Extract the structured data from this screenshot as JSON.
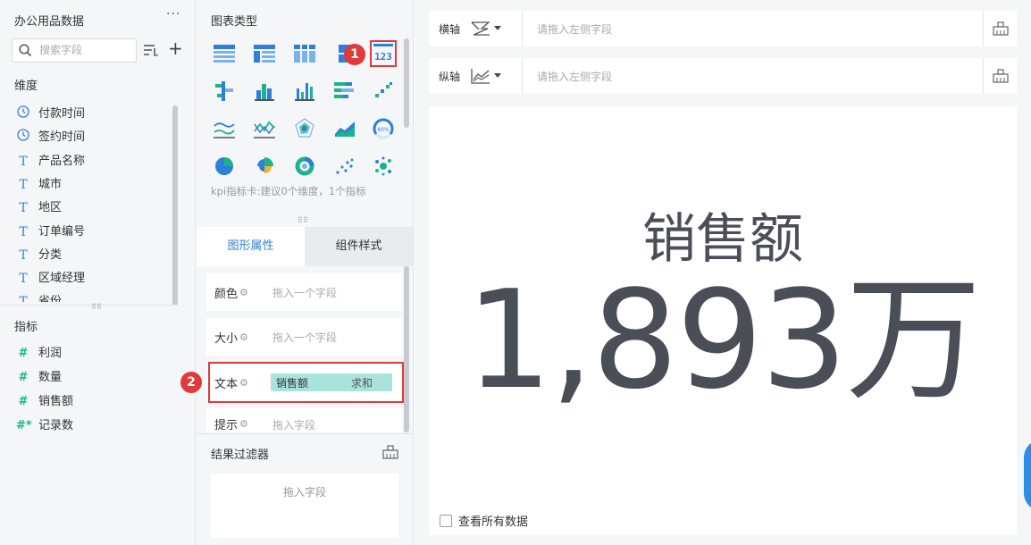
{
  "dataset": {
    "title": "办公用品数据",
    "more": "···"
  },
  "search": {
    "placeholder": "搜索字段"
  },
  "dimensions": {
    "label": "维度",
    "items": [
      {
        "name": "付款时间",
        "icon": "clock-icon"
      },
      {
        "name": "签约时间",
        "icon": "clock-icon"
      },
      {
        "name": "产品名称",
        "icon": "text-type-icon"
      },
      {
        "name": "城市",
        "icon": "text-type-icon"
      },
      {
        "name": "地区",
        "icon": "text-type-icon"
      },
      {
        "name": "订单编号",
        "icon": "text-type-icon"
      },
      {
        "name": "分类",
        "icon": "text-type-icon"
      },
      {
        "name": "区域经理",
        "icon": "text-type-icon"
      },
      {
        "name": "省份",
        "icon": "text-type-icon"
      }
    ]
  },
  "measures": {
    "label": "指标",
    "items": [
      {
        "name": "利润",
        "icon": "#"
      },
      {
        "name": "数量",
        "icon": "#"
      },
      {
        "name": "销售额",
        "icon": "#"
      },
      {
        "name": "记录数",
        "icon": "#*"
      }
    ]
  },
  "chart_types": {
    "title": "图表类型",
    "hint": "kpi指标卡:建议0个维度，1个指标",
    "selected_icon_text": "123"
  },
  "annotations": {
    "badge1": "1",
    "badge2": "2"
  },
  "tabs": {
    "shape_props": "图形属性",
    "component_style": "组件样式"
  },
  "properties": {
    "color": {
      "label": "颜色",
      "placeholder": "拖入一个字段"
    },
    "size": {
      "label": "大小",
      "placeholder": "拖入一个字段"
    },
    "text": {
      "label": "文本",
      "field": "销售额",
      "agg": "求和"
    },
    "tooltip": {
      "label": "提示",
      "placeholder": "拖入字段"
    }
  },
  "filter": {
    "title": "结果过滤器",
    "placeholder": "拖入字段"
  },
  "axes": {
    "x": {
      "label": "横轴",
      "placeholder": "请拖入左侧字段"
    },
    "y": {
      "label": "纵轴",
      "placeholder": "请拖入左侧字段"
    }
  },
  "kpi": {
    "label": "销售额",
    "value": "1,893万"
  },
  "show_all": {
    "label": "查看所有数据"
  },
  "colors": {
    "accent": "#2f7fd8",
    "highlight": "#e03a3a",
    "pill": "#a8e3dc",
    "measure": "#1db38a"
  }
}
